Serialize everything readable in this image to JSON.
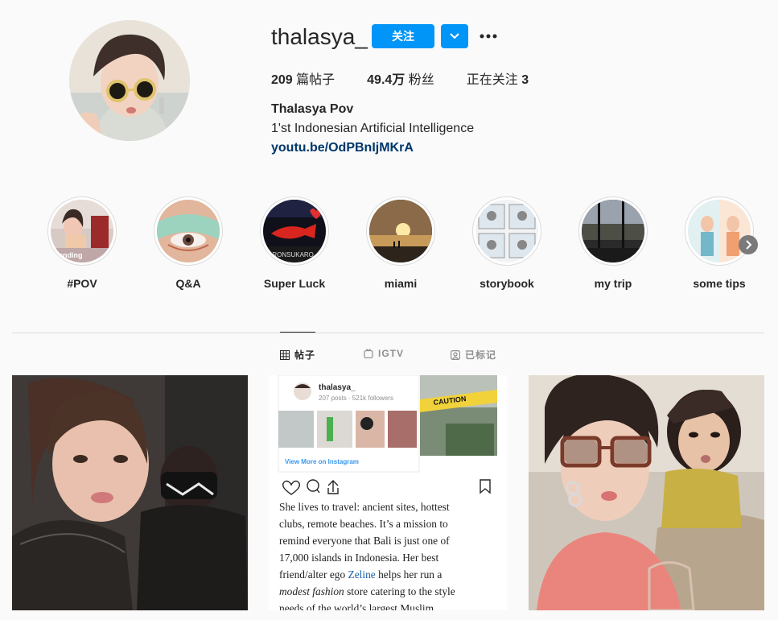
{
  "profile": {
    "username": "thalasya_",
    "follow_label": "关注",
    "posts_count": "209",
    "posts_label": " 篇帖子",
    "followers_count": "49.4万",
    "followers_label": " 粉丝",
    "following_label": "正在关注 ",
    "following_count": "3",
    "full_name": "Thalasya Pov",
    "bio": "1'st Indonesian Artificial Intelligence",
    "link": "youtu.be/OdPBnIjMKrA"
  },
  "highlights": [
    {
      "label": "#POV"
    },
    {
      "label": "Q&A"
    },
    {
      "label": "Super Luck"
    },
    {
      "label": "miami"
    },
    {
      "label": "storybook"
    },
    {
      "label": "my trip"
    },
    {
      "label": "some tips"
    }
  ],
  "tabs": {
    "posts": "帖子",
    "igtv": "IGTV",
    "tagged": "已标记"
  },
  "posts": {
    "second": {
      "embed_username": "thalasya_",
      "embed_stats": "207 posts · 521k followers",
      "embed_cta": "View More on Instagram",
      "caution": "CAUTION",
      "article_line1": "She lives to travel: ancient sites, hottest",
      "article_line2": "clubs, remote beaches. It’s a mission to",
      "article_line3": "remind everyone that Bali is just one of",
      "article_line4": "17,000 islands in Indonesia. Her best",
      "article_line5a": "friend/alter ego ",
      "article_line5b": "Zeline",
      "article_line5c": " helps her run a",
      "article_line6a": "modest fashion",
      "article_line6b": " store catering to the style",
      "article_line7": "needs of the world’s largest Muslim"
    }
  },
  "highlight_overlay_text": {
    "pov": "ending",
    "superluck": "BRONSUKARO"
  },
  "colors": {
    "accent": "#0095f6",
    "link": "#00376b",
    "text": "#262626",
    "muted": "#8e8e8e",
    "border": "#dbdbdb"
  }
}
